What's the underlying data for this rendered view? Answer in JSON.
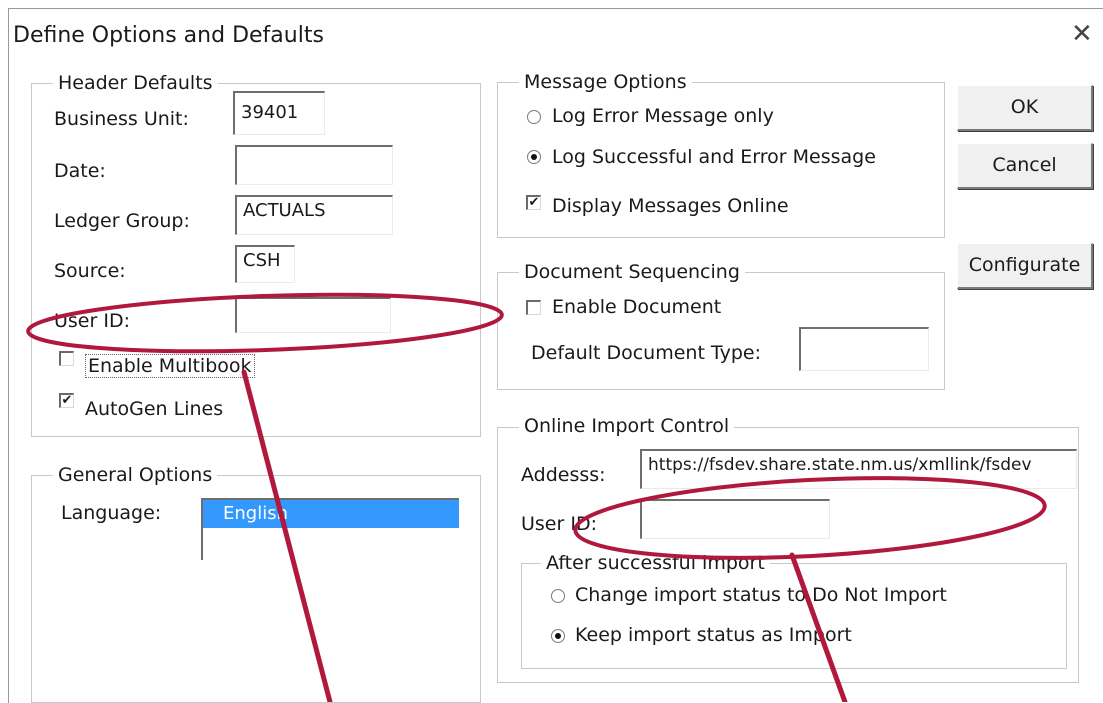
{
  "window": {
    "title": "Define Options and Defaults",
    "close_glyph": "✕"
  },
  "header_defaults": {
    "legend": "Header Defaults",
    "business_unit_label": "Business Unit:",
    "business_unit_value": "39401",
    "date_label": "Date:",
    "date_value": "",
    "ledger_group_label": "Ledger Group:",
    "ledger_group_value": "ACTUALS",
    "source_label": "Source:",
    "source_value": "CSH",
    "user_id_label": "User ID:",
    "user_id_value": "",
    "enable_multibook_label": "Enable Multibook",
    "enable_multibook_checked": false,
    "autogen_lines_label": "AutoGen Lines",
    "autogen_lines_checked": true
  },
  "general_options": {
    "legend": "General Options",
    "language_label": "Language:",
    "language_options": [
      "English"
    ],
    "language_selected": "English"
  },
  "message_options": {
    "legend": "Message Options",
    "radio_error_only": "Log Error Message only",
    "radio_success_and_error": "Log Successful and Error Message",
    "selected": "Log Successful and Error Message",
    "display_online_label": "Display Messages Online",
    "display_online_checked": true
  },
  "document_sequencing": {
    "legend": "Document Sequencing",
    "enable_document_label": "Enable Document",
    "enable_document_checked": false,
    "default_doc_type_label": "Default Document Type:",
    "default_doc_type_value": ""
  },
  "online_import": {
    "legend": "Online Import Control",
    "address_label": "Addesss:",
    "address_value": "https://fsdev.share.state.nm.us/xmllink/fsdev",
    "user_id_label": "User ID:",
    "user_id_value": "",
    "after_import": {
      "legend": "After successful import",
      "radio_do_not_import": "Change import status to Do Not Import",
      "radio_keep_import": "Keep import status as Import",
      "selected": "Keep import status as Import"
    }
  },
  "buttons": {
    "ok": "OK",
    "cancel": "Cancel",
    "configurate": "Configurate"
  },
  "annotation_color": "#b0183c"
}
